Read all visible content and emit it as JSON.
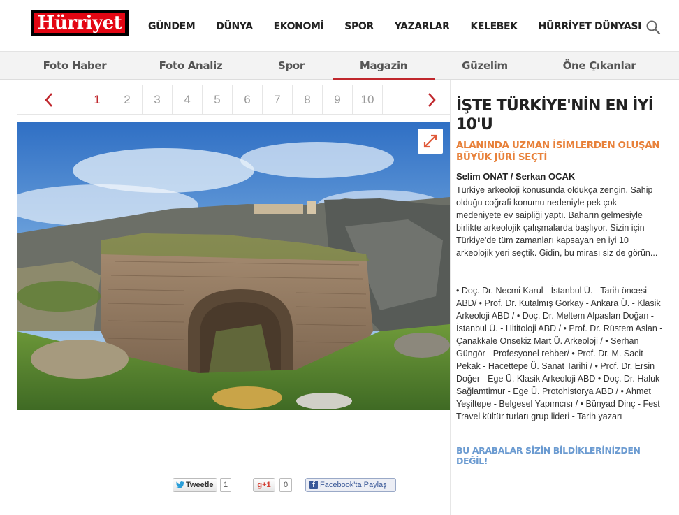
{
  "header": {
    "logo_text": "Hürriyet",
    "nav": [
      "GÜNDEM",
      "DÜNYA",
      "EKONOMİ",
      "SPOR",
      "YAZARLAR",
      "KELEBEK",
      "HÜRRİYET DÜNYASI"
    ],
    "more_icon": "chevron-down-icon",
    "search_icon": "search-icon"
  },
  "subnav": {
    "tabs": [
      "Foto Haber",
      "Foto Analiz",
      "Spor",
      "Magazin",
      "Güzelim",
      "Öne Çıkanlar"
    ],
    "active": "Magazin"
  },
  "pager": {
    "pages": [
      "1",
      "2",
      "3",
      "4",
      "5",
      "6",
      "7",
      "8",
      "9",
      "10"
    ],
    "current": "1",
    "prev_icon": "chevron-left-icon",
    "next_icon": "chevron-right-icon"
  },
  "photo": {
    "expand_icon": "expand-icon"
  },
  "share": {
    "tweet_label": "Tweetle",
    "tweet_count": "1",
    "gplus_label": "g+1",
    "gplus_count": "0",
    "facebook_label": "Facebook'ta Paylaş"
  },
  "article": {
    "title": "İŞTE TÜRKİYE'NİN EN İYİ 10'U",
    "subtitle": "ALANINDA UZMAN İSİMLERDEN OLUŞAN BÜYÜK JÜRİ SEÇTİ",
    "authors": "Selim ONAT / Serkan OCAK",
    "body": "Türkiye arkeoloji konusunda oldukça zengin. Sahip olduğu coğrafi konumu nedeniyle pek çok medeniyete ev saipliği yaptı. Baharın gelmesiyle birlikte arkeolojik çalışmalarda başlıyor. Sizin için Türkiye'de tüm zamanları kapsayan en iyi 10 arkeolojik yeri seçtik. Gidin, bu mirası siz de görün...",
    "experts": "• Doç. Dr. Necmi Karul - İstanbul Ü. - Tarih öncesi ABD/ • Prof. Dr. Kutalmış Görkay - Ankara Ü. - Klasik Arkeoloji ABD / • Doç. Dr. Meltem Alpaslan Doğan - İstanbul Ü. - Hititoloji ABD / • Prof. Dr. Rüstem Aslan - Çanakkale Onsekiz Mart Ü. Arkeoloji / • Serhan Güngör - Profesyonel rehber/ • Prof. Dr. M. Sacit Pekak - Hacettepe Ü. Sanat Tarihi / • Prof. Dr. Ersin Doğer - Ege Ü. Klasik Arkeoloji ABD • Doç. Dr. Haluk Sağlamtimur - Ege Ü. Protohistorya ABD / • Ahmet Yeşiltepe - Belgesel Yapımcısı / • Bünyad Dinç - Fest Travel kültür turları grup lideri - Tarih yazarı",
    "related_link": "BU ARABALAR SİZİN BİLDİKLERİNİZDEN DEĞİL!"
  },
  "colors": {
    "brand_red": "#e30613",
    "accent_red": "#c0272d",
    "subtitle_orange": "#e8813a",
    "link_blue": "#6b9bd1"
  }
}
